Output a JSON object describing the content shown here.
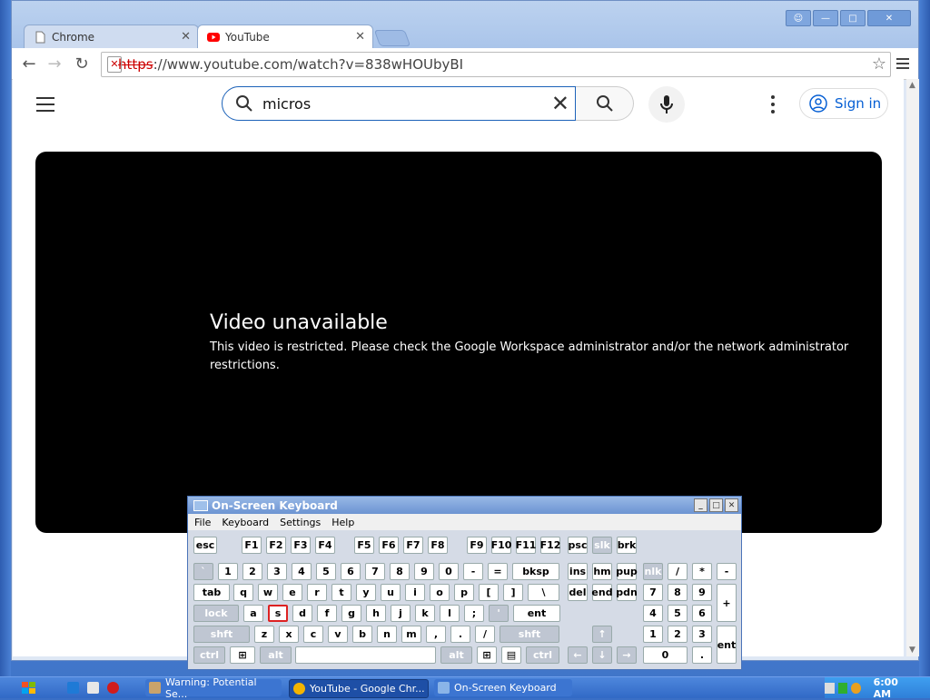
{
  "browser": {
    "tabs": [
      {
        "label": "Chrome",
        "active": false
      },
      {
        "label": "YouTube",
        "active": true
      }
    ],
    "url_protocol": "https",
    "url_rest": "://www.youtube.com/watch?v=838wHOUbyBI"
  },
  "youtube": {
    "search_query": "micros",
    "signin_label": "Sign in",
    "error_title": "Video unavailable",
    "error_message": "This video is restricted. Please check the Google Workspace administrator and/or the network administrator restrictions."
  },
  "osk": {
    "title": "On-Screen Keyboard",
    "menu": [
      "File",
      "Keyboard",
      "Settings",
      "Help"
    ],
    "highlighted_key": "s"
  },
  "taskbar": {
    "items": [
      {
        "label": "Warning: Potential Se..."
      },
      {
        "label": "YouTube - Google Chr..."
      },
      {
        "label": "On-Screen Keyboard"
      }
    ],
    "clock": "6:00 AM"
  },
  "colors": {
    "accent": "#065fd4",
    "youtube_red": "#ff0000",
    "player_bg": "#000000"
  }
}
